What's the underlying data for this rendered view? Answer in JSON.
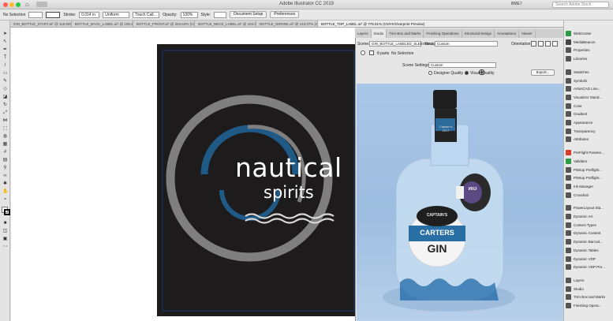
{
  "window": {
    "title": "Adobe Illustrator CC 2019",
    "search_placeholder": "Search Adobe Stock",
    "workspace": "BME7"
  },
  "control_bar": {
    "selection_label": "No Selection",
    "stroke_label": "Stroke:",
    "stroke_value": "0.014 in",
    "profile_value": "Uniform",
    "brush_value": "Touch Call...",
    "opacity_label": "Opacity:",
    "opacity_value": "100%",
    "style_label": "Style:",
    "document_setup": "Document Setup",
    "preferences": "Preferences"
  },
  "doc_tabs": [
    "GIN_BOTTLE_START.ai* @ 118.83% (CMYK...",
    "BOTTLE_BACK_LABEL.ai* @ 105.28% (CMY...",
    "BOTTLE_FRONT.ai* @ 264.63% (CMYK/Gu...",
    "BOTTLE_NECK_LABEL.ai* @ 104.93% (CMY...",
    "BOTTLE_SHRINK.ai* @ 143.07% (CMYK/Gu...",
    "BOTTLE_TOP_LABEL.ai* @ 775.61% (CMYK/Overprint Preview)"
  ],
  "artwork": {
    "line1": "nautical",
    "line2": "spirits"
  },
  "studio_panel": {
    "tabs": [
      "Layers",
      "Studio",
      "Trim Box and Marks",
      "Finishing Operations",
      "Structural Design",
      "Annotations",
      "Viewer"
    ],
    "scene_label": "Scene:",
    "scene_value": "GIN_BOTTLE_LABELED_SLEEVED.zip",
    "view_label": "View:",
    "view_value": "Custom",
    "orientation_label": "Orientation:",
    "parts_label": "8 parts",
    "selection_state": "No Selection",
    "scene_settings_label": "Scene Settings:",
    "scene_settings_value": "Custom",
    "designer_quality": "Designer Quality",
    "visual_quality": "Visual Quality",
    "export_button": "Export..."
  },
  "bottle": {
    "neck_text": "Captain's 2017",
    "label_top": "CAPTAIN'S",
    "label_mid": "CARTERS",
    "label_gin": "GIN",
    "back_label": "GIN"
  },
  "right_panel": {
    "items": [
      {
        "label": "WebCenter",
        "icon": "webcenter-icon",
        "color": "#2e9a44"
      },
      {
        "label": "MediaBeacon",
        "icon": "mediabeacon-icon",
        "color": "#444444"
      },
      {
        "label": "Properties",
        "icon": "properties-icon",
        "color": "#555555"
      },
      {
        "label": "Libraries",
        "icon": "libraries-icon",
        "color": "#555555"
      },
      {
        "label": "Swatches",
        "icon": "swatches-icon",
        "color": "#555555"
      },
      {
        "label": "Symbols",
        "icon": "symbols-icon",
        "color": "#555555"
      },
      {
        "label": "ArtiosCAD Line...",
        "icon": "artioscad-icon",
        "color": "#555555"
      },
      {
        "label": "Visualizer Stand...",
        "icon": "visualizer-icon",
        "color": "#555555"
      },
      {
        "label": "Color",
        "icon": "color-icon",
        "color": "#555555"
      },
      {
        "label": "Gradient",
        "icon": "gradient-icon",
        "color": "#555555"
      },
      {
        "label": "Appearance",
        "icon": "appearance-icon",
        "color": "#555555"
      },
      {
        "label": "Transparency",
        "icon": "transparency-icon",
        "color": "#555555"
      },
      {
        "label": "Attributes",
        "icon": "attributes-icon",
        "color": "#555555"
      },
      {
        "label": "PreFlight Parame...",
        "icon": "preflight-params-icon",
        "color": "#d93a2b"
      },
      {
        "label": "Validator",
        "icon": "validator-icon",
        "color": "#2e9a44"
      },
      {
        "label": "PitStop Preflight...",
        "icon": "pitstop-icon",
        "color": "#555555"
      },
      {
        "label": "PitStop Preflight...",
        "icon": "pitstop-icon",
        "color": "#555555"
      },
      {
        "label": "Ink Manager",
        "icon": "ink-manager-icon",
        "color": "#555555"
      },
      {
        "label": "Crosshair",
        "icon": "crosshair-icon",
        "color": "#555555"
      },
      {
        "label": "PowerLayout Sta...",
        "icon": "powerlayout-icon",
        "color": "#555555"
      },
      {
        "label": "Dynamic Art",
        "icon": "dynamic-art-icon",
        "color": "#555555"
      },
      {
        "label": "Content Types",
        "icon": "content-types-icon",
        "color": "#555555"
      },
      {
        "label": "Dynamic Content",
        "icon": "dynamic-content-icon",
        "color": "#555555"
      },
      {
        "label": "Dynamic Barcod...",
        "icon": "dynamic-barcode-icon",
        "color": "#555555"
      },
      {
        "label": "Dynamic Tables",
        "icon": "dynamic-tables-icon",
        "color": "#555555"
      },
      {
        "label": "Dynamic VDP",
        "icon": "dynamic-vdp-icon",
        "color": "#555555"
      },
      {
        "label": "Dynamic VDP Pre...",
        "icon": "dynamic-vdp-icon",
        "color": "#555555"
      },
      {
        "label": "Layers",
        "icon": "layers-icon",
        "color": "#555555"
      },
      {
        "label": "Studio",
        "icon": "studio-icon",
        "color": "#555555"
      },
      {
        "label": "Trim Box and Marks",
        "icon": "trim-box-icon",
        "color": "#555555"
      },
      {
        "label": "Finishing Opera...",
        "icon": "finishing-icon",
        "color": "#555555"
      }
    ]
  },
  "colors": {
    "artboard_bg": "#1d1b1c",
    "spiral_gray": "#8a8a8a",
    "spiral_blue": "#1f5a86",
    "text_white": "#ffffff",
    "render_sky": "#a9c6e6"
  }
}
